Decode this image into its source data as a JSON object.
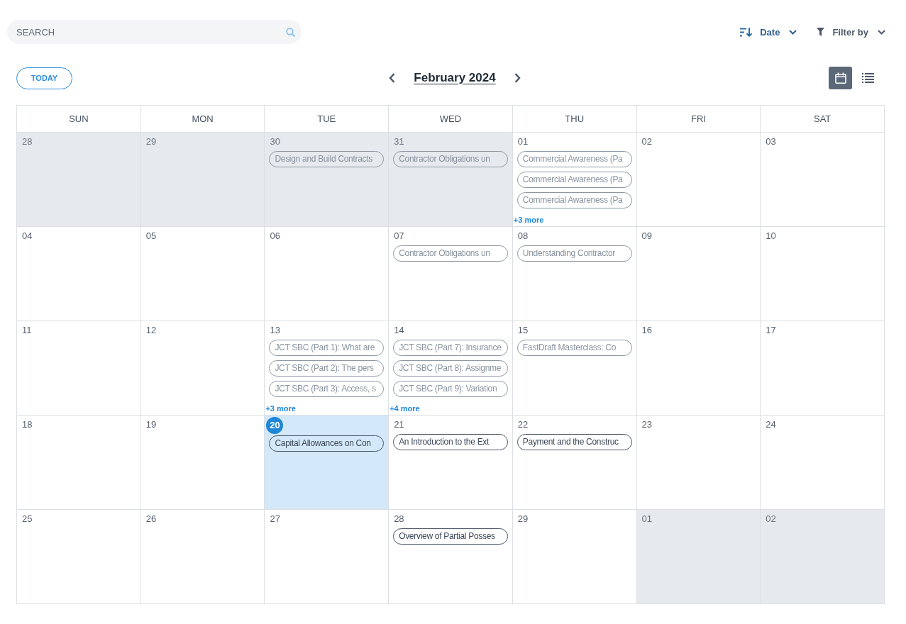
{
  "search": {
    "placeholder": "SEARCH"
  },
  "sort": {
    "label": "Date"
  },
  "filter": {
    "label": "Filter by"
  },
  "today_button": {
    "label": "TODAY"
  },
  "month_title": "February 2024",
  "views": [
    {
      "kind": "calendar",
      "selected": true
    },
    {
      "kind": "list",
      "selected": false
    }
  ],
  "weekdays": [
    "SUN",
    "MON",
    "TUE",
    "WED",
    "THU",
    "FRI",
    "SAT"
  ],
  "weeks": [
    {
      "days": [
        {
          "date": "28",
          "in_month": false,
          "today": false
        },
        {
          "date": "29",
          "in_month": false,
          "today": false
        },
        {
          "date": "30",
          "in_month": false,
          "today": false,
          "events": [
            {
              "title": "Design and Build Contracts",
              "past": true
            }
          ]
        },
        {
          "date": "31",
          "in_month": false,
          "today": false,
          "events": [
            {
              "title": "Contractor Obligations un",
              "past": true
            }
          ]
        },
        {
          "date": "01",
          "in_month": true,
          "today": false,
          "events": [
            {
              "title": "Commercial Awareness (Pa",
              "past": true
            },
            {
              "title": "Commercial Awareness (Pa",
              "past": true
            },
            {
              "title": "Commercial Awareness (Pa",
              "past": true
            }
          ],
          "more": "+3 more"
        },
        {
          "date": "02",
          "in_month": true,
          "today": false
        },
        {
          "date": "03",
          "in_month": true,
          "today": false
        }
      ]
    },
    {
      "days": [
        {
          "date": "04",
          "in_month": true,
          "today": false
        },
        {
          "date": "05",
          "in_month": true,
          "today": false
        },
        {
          "date": "06",
          "in_month": true,
          "today": false
        },
        {
          "date": "07",
          "in_month": true,
          "today": false,
          "events": [
            {
              "title": "Contractor Obligations un",
              "past": true
            }
          ]
        },
        {
          "date": "08",
          "in_month": true,
          "today": false,
          "events": [
            {
              "title": "Understanding Contractor",
              "past": true
            }
          ]
        },
        {
          "date": "09",
          "in_month": true,
          "today": false
        },
        {
          "date": "10",
          "in_month": true,
          "today": false
        }
      ]
    },
    {
      "days": [
        {
          "date": "11",
          "in_month": true,
          "today": false
        },
        {
          "date": "12",
          "in_month": true,
          "today": false
        },
        {
          "date": "13",
          "in_month": true,
          "today": false,
          "events": [
            {
              "title": "JCT SBC (Part 1): What are",
              "past": true
            },
            {
              "title": "JCT SBC (Part 2): The pers",
              "past": true
            },
            {
              "title": "JCT SBC (Part 3): Access, s",
              "past": true
            }
          ],
          "more": "+3 more"
        },
        {
          "date": "14",
          "in_month": true,
          "today": false,
          "events": [
            {
              "title": "JCT SBC (Part 7): Insurance",
              "past": true
            },
            {
              "title": "JCT SBC (Part 8): Assignme",
              "past": true
            },
            {
              "title": "JCT SBC (Part 9): Variation",
              "past": true
            }
          ],
          "more": "+4 more"
        },
        {
          "date": "15",
          "in_month": true,
          "today": false,
          "events": [
            {
              "title": "FastDraft Masterclass: Co",
              "past": true
            }
          ]
        },
        {
          "date": "16",
          "in_month": true,
          "today": false
        },
        {
          "date": "17",
          "in_month": true,
          "today": false
        }
      ]
    },
    {
      "days": [
        {
          "date": "18",
          "in_month": true,
          "today": false
        },
        {
          "date": "19",
          "in_month": true,
          "today": false
        },
        {
          "date": "20",
          "in_month": true,
          "today": true,
          "events": [
            {
              "title": "Capital Allowances on Con",
              "past": false
            }
          ]
        },
        {
          "date": "21",
          "in_month": true,
          "today": false,
          "events": [
            {
              "title": "An Introduction to the Ext",
              "past": false
            }
          ]
        },
        {
          "date": "22",
          "in_month": true,
          "today": false,
          "events": [
            {
              "title": "Payment and the Construc",
              "past": false
            }
          ]
        },
        {
          "date": "23",
          "in_month": true,
          "today": false
        },
        {
          "date": "24",
          "in_month": true,
          "today": false
        }
      ]
    },
    {
      "days": [
        {
          "date": "25",
          "in_month": true,
          "today": false
        },
        {
          "date": "26",
          "in_month": true,
          "today": false
        },
        {
          "date": "27",
          "in_month": true,
          "today": false
        },
        {
          "date": "28",
          "in_month": true,
          "today": false,
          "events": [
            {
              "title": "Overview of Partial Posses",
              "past": false
            }
          ]
        },
        {
          "date": "29",
          "in_month": true,
          "today": false
        },
        {
          "date": "01",
          "in_month": false,
          "today": false
        },
        {
          "date": "02",
          "in_month": false,
          "today": false
        }
      ]
    }
  ]
}
